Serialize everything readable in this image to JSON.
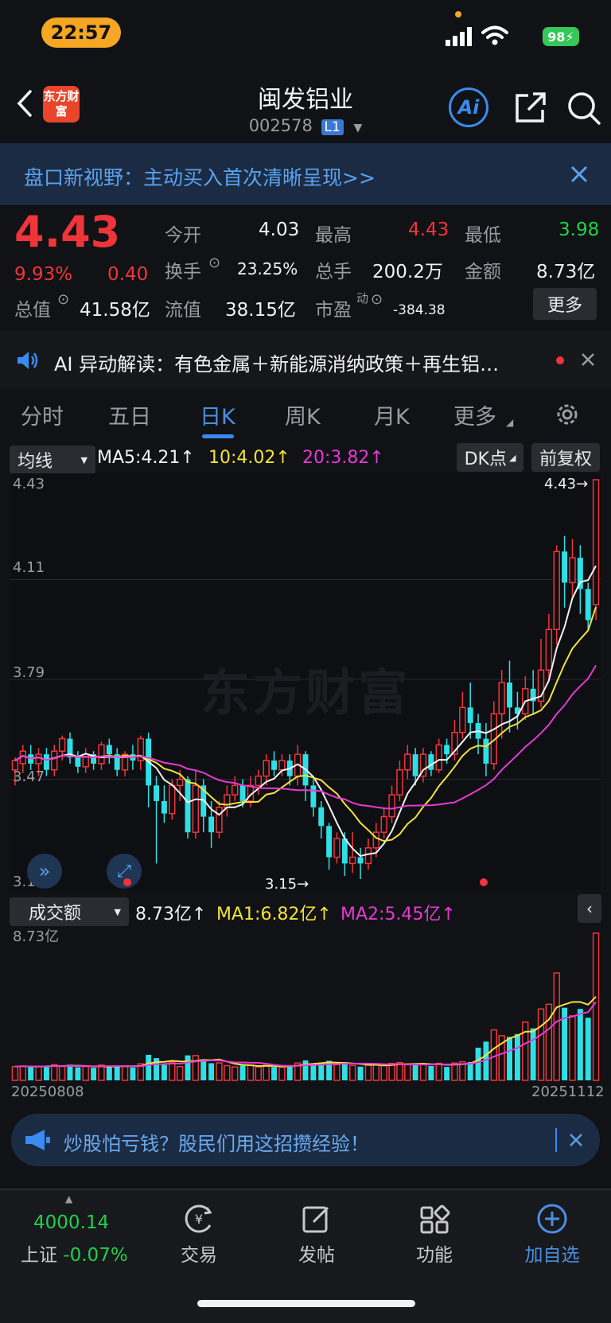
{
  "status": {
    "time": "22:57",
    "battery": "98"
  },
  "header": {
    "title": "闽发铝业",
    "code": "002578",
    "level": "L1",
    "logo_text": "东方财富"
  },
  "banner": {
    "text": "盘口新视野：主动买入首次清晰呈现>>"
  },
  "quote": {
    "price": "4.43",
    "pct": "9.93%",
    "change": "0.40",
    "open_label": "今开",
    "open": "4.03",
    "high_label": "最高",
    "high": "4.43",
    "low_label": "最低",
    "low": "3.98",
    "turnover_label": "换手",
    "turnover": "23.25%",
    "volume_label": "总手",
    "volume": "200.2万",
    "amount_label": "金额",
    "amount": "8.73亿",
    "mktcap_label": "总值",
    "mktcap": "41.58亿",
    "float_label": "流值",
    "float": "38.15亿",
    "pe_label": "市盈",
    "pe_sup": "动",
    "pe": "-384.38",
    "more": "更多"
  },
  "ai_bar": {
    "text": "AI 异动解读：有色金属＋新能源消纳政策＋再生铝…"
  },
  "tabs": [
    {
      "label": "分时"
    },
    {
      "label": "五日"
    },
    {
      "label": "日K"
    },
    {
      "label": "周K"
    },
    {
      "label": "月K"
    },
    {
      "label": "更多"
    }
  ],
  "kline": {
    "ma_select": "均线",
    "ma5": "MA5:4.21↑",
    "ma10": "10:4.02↑",
    "ma20": "20:3.82↑",
    "dk_btn": "DK点",
    "fq_btn": "前复权",
    "y_labels": [
      "4.43",
      "4.11",
      "3.79",
      "3.47",
      "3.15"
    ],
    "max_label": "4.43→",
    "min_label": "3.15→",
    "watermark": "东方财富"
  },
  "volume": {
    "select": "成交额",
    "value": "8.73亿↑",
    "ma1": "MA1:6.82亿↑",
    "ma2": "MA2:5.45亿↑",
    "y_label": "8.73亿",
    "date_start": "20250808",
    "date_end": "20251112"
  },
  "ad": {
    "text": "炒股怕亏钱？股民们用这招攒经验！"
  },
  "bottom": {
    "index_value": "4000.14",
    "index_name": "上证",
    "index_pct": "-0.07%",
    "items": [
      {
        "label": "交易"
      },
      {
        "label": "发帖"
      },
      {
        "label": "功能"
      },
      {
        "label": "加自选"
      }
    ]
  },
  "chart_data": {
    "type": "candlestick",
    "y_range": [
      3.15,
      4.43
    ],
    "candles": [
      [
        3.5,
        3.53,
        3.45,
        3.54
      ],
      [
        3.52,
        3.56,
        3.49,
        3.58
      ],
      [
        3.55,
        3.52,
        3.5,
        3.58
      ],
      [
        3.52,
        3.55,
        3.48,
        3.57
      ],
      [
        3.55,
        3.5,
        3.48,
        3.57
      ],
      [
        3.5,
        3.56,
        3.48,
        3.58
      ],
      [
        3.56,
        3.6,
        3.53,
        3.61
      ],
      [
        3.6,
        3.54,
        3.52,
        3.62
      ],
      [
        3.54,
        3.51,
        3.49,
        3.56
      ],
      [
        3.51,
        3.55,
        3.49,
        3.57
      ],
      [
        3.55,
        3.52,
        3.5,
        3.56
      ],
      [
        3.52,
        3.58,
        3.5,
        3.59
      ],
      [
        3.58,
        3.55,
        3.52,
        3.6
      ],
      [
        3.55,
        3.5,
        3.48,
        3.57
      ],
      [
        3.5,
        3.55,
        3.48,
        3.56
      ],
      [
        3.55,
        3.53,
        3.5,
        3.58
      ],
      [
        3.53,
        3.6,
        3.5,
        3.61
      ],
      [
        3.6,
        3.45,
        3.38,
        3.62
      ],
      [
        3.45,
        3.4,
        3.2,
        3.48
      ],
      [
        3.4,
        3.36,
        3.33,
        3.45
      ],
      [
        3.36,
        3.45,
        3.34,
        3.47
      ],
      [
        3.45,
        3.47,
        3.4,
        3.5
      ],
      [
        3.47,
        3.3,
        3.28,
        3.48
      ],
      [
        3.3,
        3.45,
        3.28,
        3.5
      ],
      [
        3.45,
        3.35,
        3.3,
        3.47
      ],
      [
        3.35,
        3.3,
        3.25,
        3.4
      ],
      [
        3.3,
        3.38,
        3.28,
        3.4
      ],
      [
        3.38,
        3.42,
        3.35,
        3.45
      ],
      [
        3.42,
        3.45,
        3.4,
        3.48
      ],
      [
        3.45,
        3.4,
        3.38,
        3.47
      ],
      [
        3.4,
        3.45,
        3.38,
        3.48
      ],
      [
        3.45,
        3.48,
        3.42,
        3.5
      ],
      [
        3.48,
        3.53,
        3.45,
        3.55
      ],
      [
        3.53,
        3.5,
        3.48,
        3.56
      ],
      [
        3.5,
        3.53,
        3.48,
        3.55
      ],
      [
        3.53,
        3.48,
        3.45,
        3.55
      ],
      [
        3.48,
        3.55,
        3.45,
        3.58
      ],
      [
        3.55,
        3.45,
        3.4,
        3.56
      ],
      [
        3.45,
        3.38,
        3.35,
        3.47
      ],
      [
        3.38,
        3.32,
        3.28,
        3.4
      ],
      [
        3.32,
        3.22,
        3.18,
        3.33
      ],
      [
        3.22,
        3.28,
        3.2,
        3.3
      ],
      [
        3.28,
        3.2,
        3.16,
        3.3
      ],
      [
        3.2,
        3.22,
        3.17,
        3.3
      ],
      [
        3.22,
        3.2,
        3.15,
        3.25
      ],
      [
        3.2,
        3.25,
        3.18,
        3.28
      ],
      [
        3.25,
        3.3,
        3.22,
        3.33
      ],
      [
        3.3,
        3.35,
        3.28,
        3.38
      ],
      [
        3.35,
        3.42,
        3.33,
        3.45
      ],
      [
        3.42,
        3.5,
        3.4,
        3.53
      ],
      [
        3.5,
        3.55,
        3.47,
        3.58
      ],
      [
        3.55,
        3.48,
        3.45,
        3.57
      ],
      [
        3.48,
        3.55,
        3.46,
        3.57
      ],
      [
        3.55,
        3.5,
        3.48,
        3.56
      ],
      [
        3.5,
        3.58,
        3.49,
        3.6
      ],
      [
        3.58,
        3.55,
        3.52,
        3.6
      ],
      [
        3.55,
        3.62,
        3.53,
        3.66
      ],
      [
        3.62,
        3.7,
        3.6,
        3.75
      ],
      [
        3.7,
        3.65,
        3.6,
        3.78
      ],
      [
        3.65,
        3.6,
        3.55,
        3.68
      ],
      [
        3.6,
        3.52,
        3.48,
        3.65
      ],
      [
        3.52,
        3.68,
        3.5,
        3.72
      ],
      [
        3.68,
        3.78,
        3.6,
        3.82
      ],
      [
        3.78,
        3.7,
        3.62,
        3.85
      ],
      [
        3.7,
        3.68,
        3.63,
        3.75
      ],
      [
        3.68,
        3.76,
        3.66,
        3.8
      ],
      [
        3.76,
        3.72,
        3.68,
        3.82
      ],
      [
        3.72,
        3.82,
        3.7,
        3.92
      ],
      [
        3.82,
        3.95,
        3.78,
        4.0
      ],
      [
        3.95,
        4.2,
        3.9,
        4.22
      ],
      [
        4.2,
        4.1,
        4.02,
        4.25
      ],
      [
        4.1,
        4.18,
        4.05,
        4.24
      ],
      [
        4.18,
        4.08,
        4.0,
        4.22
      ],
      [
        4.08,
        3.98,
        3.95,
        4.1
      ],
      [
        4.03,
        4.43,
        3.98,
        4.43
      ]
    ]
  }
}
